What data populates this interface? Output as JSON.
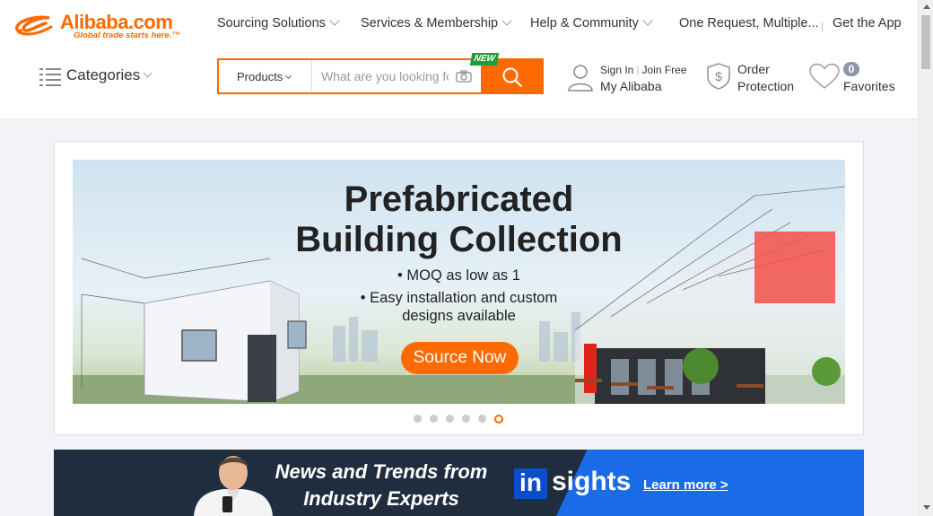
{
  "brand": {
    "name": "Alibaba.com",
    "tagline": "Global trade starts here.™",
    "accent_color": "#ff6a00"
  },
  "topnav": {
    "items": [
      {
        "label": "Sourcing Solutions",
        "has_dropdown": true
      },
      {
        "label": "Services & Membership",
        "has_dropdown": true
      },
      {
        "label": "Help & Community",
        "has_dropdown": true
      },
      {
        "label": "One Request, Multiple...",
        "has_dropdown": false
      },
      {
        "label": "Get the App",
        "has_dropdown": false
      }
    ]
  },
  "categories": {
    "label": "Categories",
    "icon": "hamburger-icon"
  },
  "search": {
    "type_label": "Products",
    "placeholder": "What are you looking for...",
    "new_badge": "NEW",
    "camera_icon": "camera-icon",
    "button_icon": "search-icon"
  },
  "account": {
    "sign_in": "Sign In",
    "join_free": "Join Free",
    "my_alibaba": "My Alibaba",
    "icon": "user-icon"
  },
  "order_protection": {
    "line1": "Order",
    "line2": "Protection",
    "icon": "shield-dollar-icon"
  },
  "favorites": {
    "count": "0",
    "label": "Favorites",
    "icon": "heart-icon"
  },
  "banner": {
    "title_line1": "Prefabricated",
    "title_line2": "Building Collection",
    "bullet1": "• MOQ as low as 1",
    "bullet2": "• Easy installation and custom",
    "bullet3": "designs available",
    "cta": "Source Now",
    "slide_count": 6,
    "active_slide": 6
  },
  "insights": {
    "headline_line1": "News and Trends from",
    "headline_line2": "Industry Experts",
    "logo_in": "in",
    "logo_rest": "sights",
    "cta": "Learn more >"
  }
}
